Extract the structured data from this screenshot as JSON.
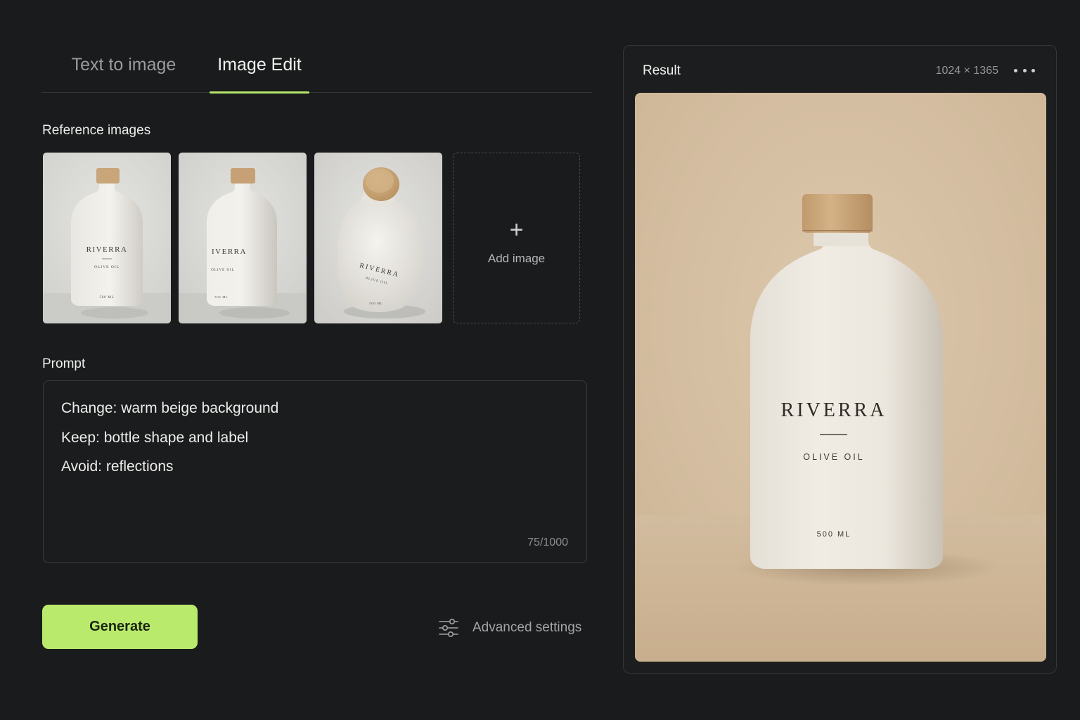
{
  "tabs": [
    {
      "label": "Text to image",
      "active": false
    },
    {
      "label": "Image Edit",
      "active": true
    }
  ],
  "accent_color": "#b9ea6c",
  "reference": {
    "label": "Reference images",
    "images": [
      {
        "brand": "RIVERRA",
        "product": "OLIVE OIL",
        "volume": "500 ML",
        "view": "front"
      },
      {
        "brand": "RIVERRA",
        "product": "OLIVE OIL",
        "volume": "500 ML",
        "view": "angled"
      },
      {
        "brand": "RIVERRA",
        "product": "OLIVE OIL",
        "volume": "500 ML",
        "view": "top-down"
      }
    ],
    "add_image_label": "Add image",
    "add_icon": "plus-icon"
  },
  "prompt": {
    "label": "Prompt",
    "lines": [
      "Change: warm beige background",
      "Keep: bottle shape and label",
      "Avoid: reflections"
    ],
    "char_count": "75/1000"
  },
  "actions": {
    "generate_label": "Generate",
    "advanced_label": "Advanced settings",
    "advanced_icon": "sliders-icon"
  },
  "result": {
    "title": "Result",
    "dimensions": "1024 × 1365",
    "more_icon": "more-dots-icon",
    "image": {
      "brand": "RIVERRA",
      "product": "OLIVE OIL",
      "volume": "500 ML",
      "background": "#d8c3a8"
    }
  }
}
